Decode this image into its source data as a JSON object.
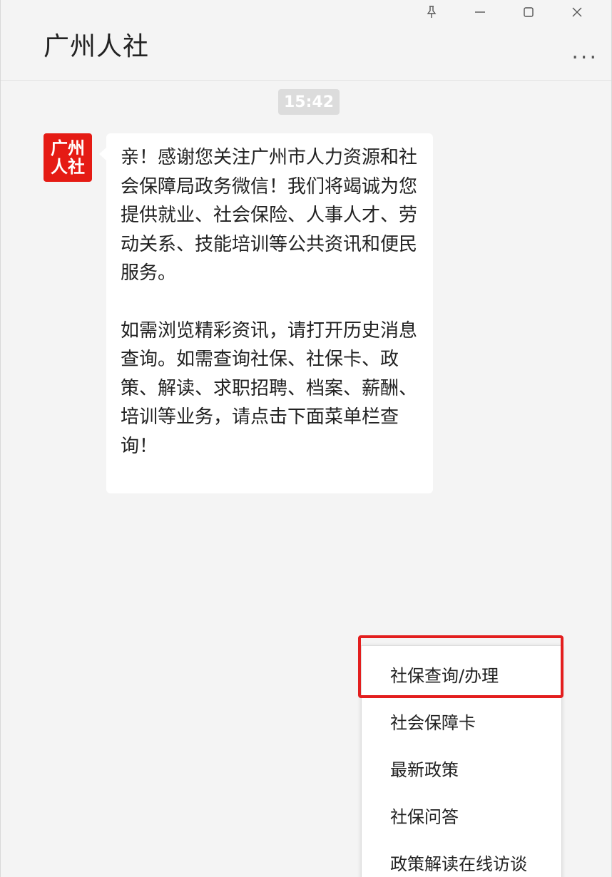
{
  "window": {
    "title": "广州人社",
    "more_label": "...",
    "controls": {
      "pin_icon": "pin-icon",
      "minimize_icon": "minimize-icon",
      "maximize_icon": "maximize-icon",
      "close_icon": "close-icon"
    }
  },
  "chat": {
    "timestamp": "15:42",
    "avatar": {
      "line1": "广州",
      "line2": "人社"
    },
    "message": {
      "paragraph1": "亲！感谢您关注广州市人力资源和社会保障局政务微信！我们将竭诚为您提供就业、社会保险、人事人才、劳动关系、技能培训等公共资讯和便民服务。",
      "paragraph2": "如需浏览精彩资讯，请打开历史消息查询。如需查询社保、社保卡、政策、解读、求职招聘、档案、薪酬、培训等业务，请点击下面菜单栏查询！"
    }
  },
  "menu": {
    "items": [
      {
        "label": "社保查询/办理"
      },
      {
        "label": "社会保障卡"
      },
      {
        "label": "最新政策"
      },
      {
        "label": "社保问答"
      },
      {
        "label": "政策解读在线访谈"
      }
    ],
    "highlight_color": "#e31e1e"
  },
  "colors": {
    "avatar_bg": "#e51b14",
    "background": "#f4f4f4",
    "bubble": "#ffffff"
  }
}
